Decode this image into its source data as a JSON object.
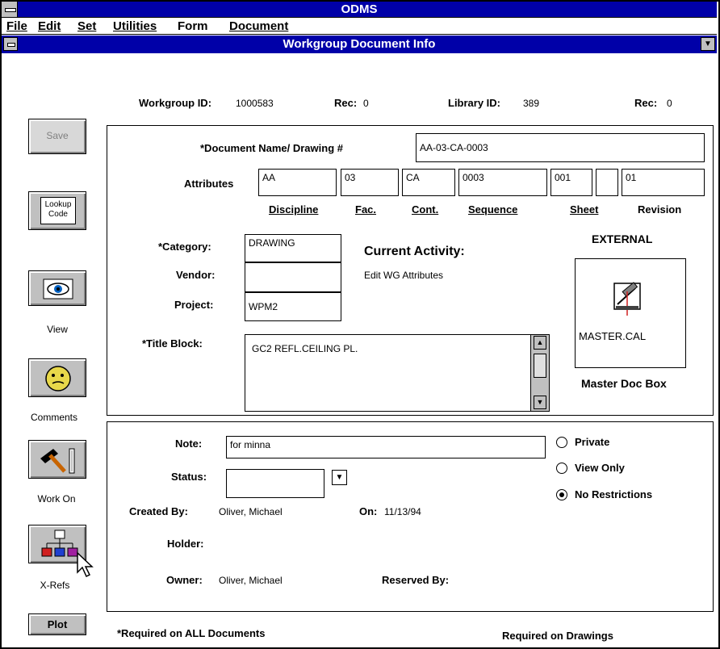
{
  "app": {
    "title": "ODMS"
  },
  "menu": {
    "file": "File",
    "edit": "Edit",
    "set": "Set",
    "utilities": "Utilities",
    "form": "Form",
    "document": "Document"
  },
  "window": {
    "title": "Workgroup Document Info"
  },
  "header": {
    "workgroup_id_label": "Workgroup ID:",
    "workgroup_id": "1000583",
    "rec1_label": "Rec:",
    "rec1": "0",
    "library_id_label": "Library ID:",
    "library_id": "389",
    "rec2_label": "Rec:",
    "rec2": "0"
  },
  "toolbar": {
    "save": "Save",
    "lookup_line1": "Lookup",
    "lookup_line2": "Code",
    "view": "View",
    "comments": "Comments",
    "work_on": "Work On",
    "xrefs": "X-Refs",
    "plot": "Plot"
  },
  "doc": {
    "name_label": "*Document Name/ Drawing #",
    "name_value": "AA-03-CA-0003",
    "attributes_label": "Attributes",
    "attributes": [
      "AA",
      "03",
      "CA",
      "0003",
      "001",
      "",
      "01"
    ],
    "attr_captions": [
      "Discipline",
      "Fac.",
      "Cont.",
      "Sequence",
      "Sheet",
      "Revision"
    ],
    "category_label": "*Category:",
    "category": "DRAWING",
    "vendor_label": "Vendor:",
    "vendor": "",
    "project_label": "Project:",
    "project": "WPM2",
    "current_activity_label": "Current Activity:",
    "current_activity": "Edit WG Attributes",
    "external_label": "EXTERNAL",
    "master_file": "MASTER.CAL",
    "master_doc_box": "Master Doc Box",
    "title_block_label": "*Title Block:",
    "title_block": "GC2 REFL.CEILING PL."
  },
  "details": {
    "note_label": "Note:",
    "note": "for minna",
    "status_label": "Status:",
    "status": "",
    "created_by_label": "Created By:",
    "created_by": "Oliver, Michael",
    "on_label": "On:",
    "on": "11/13/94",
    "holder_label": "Holder:",
    "owner_label": "Owner:",
    "owner": "Oliver, Michael",
    "reserved_by_label": "Reserved By:",
    "radio_private": "Private",
    "radio_view_only": "View Only",
    "radio_no_restrictions": "No Restrictions",
    "selected_radio": "No Restrictions"
  },
  "footer": {
    "required_all": "*Required on ALL Documents",
    "required_drawings": "Required on Drawings"
  },
  "colors": {
    "titlebar": "#0000a8",
    "button_face": "#c0c0c0"
  }
}
